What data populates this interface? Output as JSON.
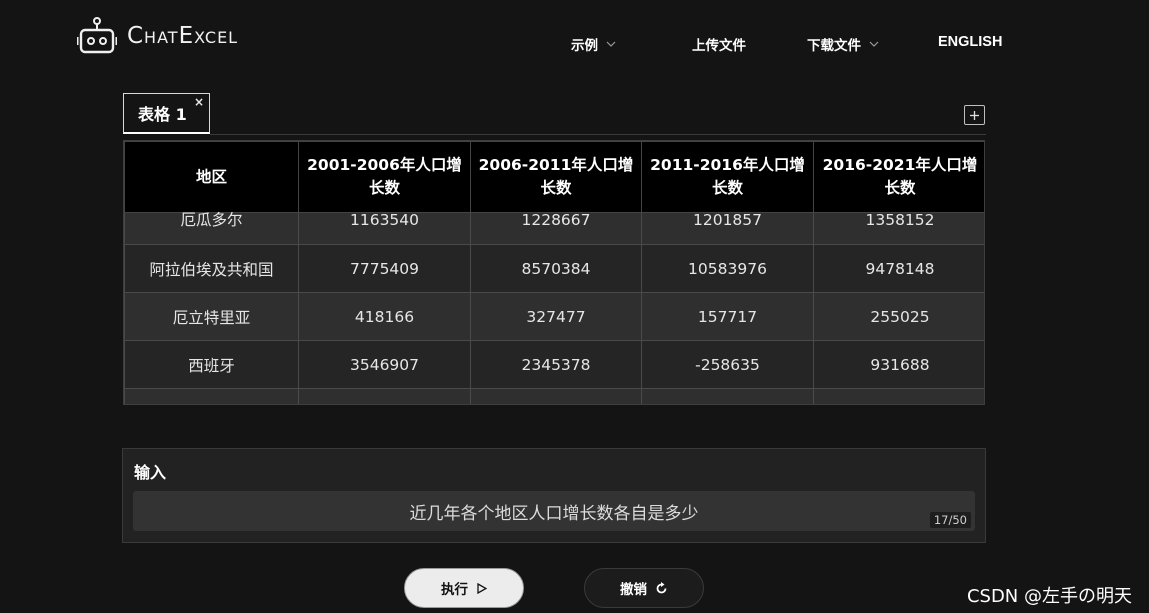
{
  "header": {
    "logo_text": "ChatExcel",
    "nav": {
      "examples": "示例",
      "upload": "上传文件",
      "download": "下载文件",
      "language": "ENGLISH"
    }
  },
  "tabs": [
    {
      "label": "表格 1",
      "close": "×"
    }
  ],
  "table": {
    "columns": [
      "地区",
      "2001-2006年人口增长数",
      "2006-2011年人口增长数",
      "2011-2016年人口增长数",
      "2016-2021年人口增长数"
    ],
    "rows": [
      [
        "厄瓜多尔",
        "1163540",
        "1228667",
        "1201857",
        "1358152"
      ],
      [
        "阿拉伯埃及共和国",
        "7775409",
        "8570384",
        "10583976",
        "9478148"
      ],
      [
        "厄立特里亚",
        "418166",
        "327477",
        "157717",
        "255025"
      ],
      [
        "西班牙",
        "3546907",
        "2345378",
        "-258635",
        "931688"
      ],
      [
        "",
        "",
        "",
        "",
        ""
      ]
    ]
  },
  "input": {
    "label": "输入",
    "value": "近几年各个地区人口增长数各自是多少",
    "counter": "17/50"
  },
  "buttons": {
    "run": "执行",
    "undo": "撤销"
  },
  "watermark": "CSDN @左手の明天",
  "icons": {
    "logo": "robot-icon",
    "chevron": "chevron-down-icon",
    "add": "plus-icon",
    "run": "play-icon",
    "undo": "undo-icon"
  }
}
